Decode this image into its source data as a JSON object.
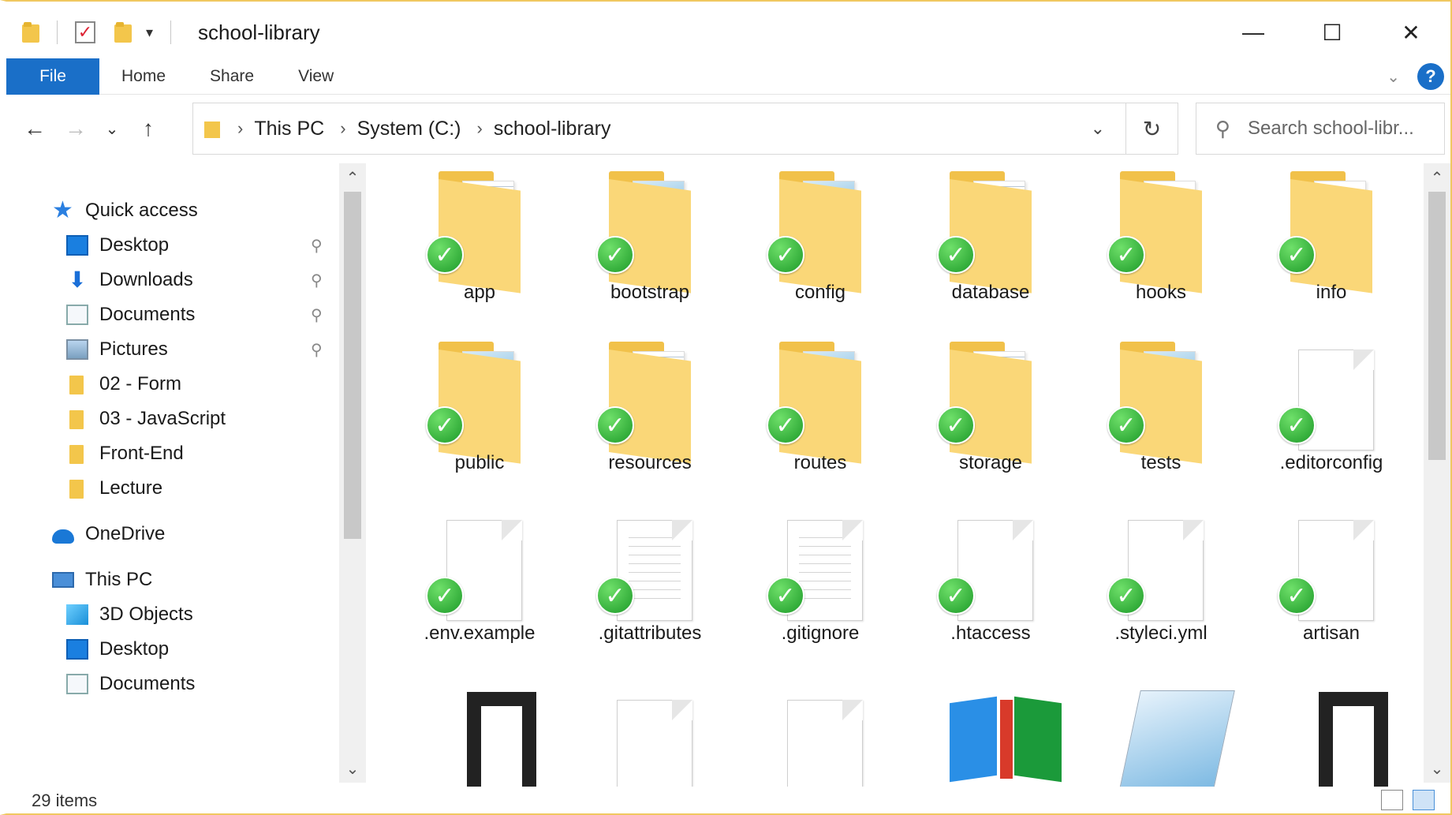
{
  "window": {
    "title": "school-library",
    "controls": {
      "minimize": "—",
      "maximize": "☐",
      "close": "✕"
    }
  },
  "ribbon": {
    "tabs": [
      "File",
      "Home",
      "Share",
      "View"
    ],
    "help": "?"
  },
  "nav": {
    "back": "←",
    "forward": "→",
    "recent": "⌄",
    "up": "↑",
    "breadcrumb": [
      "This PC",
      "System (C:)",
      "school-library"
    ],
    "refresh": "↻",
    "search_placeholder": "Search school-libr..."
  },
  "sidebar": {
    "quick_access": "Quick access",
    "pinned": [
      {
        "label": "Desktop",
        "icon": "desktop-icon"
      },
      {
        "label": "Downloads",
        "icon": "download-icon"
      },
      {
        "label": "Documents",
        "icon": "documents-icon"
      },
      {
        "label": "Pictures",
        "icon": "pictures-icon"
      }
    ],
    "folders": [
      "02 - Form",
      "03 - JavaScript",
      "Front-End",
      "Lecture"
    ],
    "onedrive": "OneDrive",
    "this_pc": "This PC",
    "pc_items": [
      {
        "label": "3D Objects",
        "icon": "3d-objects-icon"
      },
      {
        "label": "Desktop",
        "icon": "desktop-icon"
      },
      {
        "label": "Documents",
        "icon": "documents-icon"
      }
    ]
  },
  "files": [
    {
      "name": "app",
      "kind": "folder-doc"
    },
    {
      "name": "bootstrap",
      "kind": "folder-notepad"
    },
    {
      "name": "config",
      "kind": "folder-notepad"
    },
    {
      "name": "database",
      "kind": "folder-lines"
    },
    {
      "name": "hooks",
      "kind": "folder-plain"
    },
    {
      "name": "info",
      "kind": "folder-plain"
    },
    {
      "name": "public",
      "kind": "folder-notepad"
    },
    {
      "name": "resources",
      "kind": "folder-doc"
    },
    {
      "name": "routes",
      "kind": "folder-notepad"
    },
    {
      "name": "storage",
      "kind": "folder-doc"
    },
    {
      "name": "tests",
      "kind": "folder-notepad"
    },
    {
      "name": ".editorconfig",
      "kind": "file"
    },
    {
      "name": ".env.example",
      "kind": "file"
    },
    {
      "name": ".gitattributes",
      "kind": "file-lined"
    },
    {
      "name": ".gitignore",
      "kind": "file-lined"
    },
    {
      "name": ".htaccess",
      "kind": "file"
    },
    {
      "name": ".styleci.yml",
      "kind": "file"
    },
    {
      "name": "artisan",
      "kind": "file"
    }
  ],
  "status": {
    "item_count": "29 items"
  },
  "colors": {
    "accent": "#1a6fc8",
    "folder": "#f3c64b",
    "sync_check": "#1c9a28",
    "window_border": "#f0c860"
  }
}
